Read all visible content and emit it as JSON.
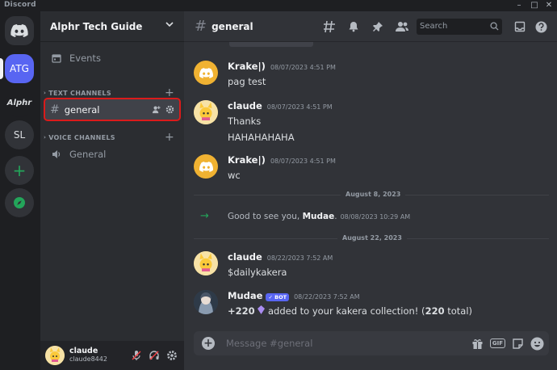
{
  "titlebar": {
    "app_name": "Discord"
  },
  "servers": [
    {
      "label": "ATG",
      "name": "Alphr Tech Guide"
    },
    {
      "label": "Alphr"
    },
    {
      "label": "SL"
    }
  ],
  "guild": {
    "name": "Alphr Tech Guide"
  },
  "sidebar": {
    "events_label": "Events",
    "text_category": "TEXT CHANNELS",
    "active_channel": "general",
    "voice_category": "VOICE CHANNELS",
    "voice_channel": "General"
  },
  "user": {
    "name": "claude",
    "tag": "claude8442"
  },
  "header": {
    "channel": "general",
    "search_placeholder": "Search"
  },
  "messages": [
    {
      "author": "Krake|)",
      "time": "08/07/2023 4:51 PM",
      "lines": [
        "pag test"
      ]
    },
    {
      "author": "claude",
      "time": "08/07/2023 4:51 PM",
      "lines": [
        "Thanks",
        "HAHAHAHAHA"
      ]
    },
    {
      "author": "Krake|)",
      "time": "08/07/2023 4:51 PM",
      "lines": [
        "wc"
      ]
    }
  ],
  "dividers": [
    "August 8, 2023",
    "August 22, 2023"
  ],
  "system_message": {
    "prefix": "Good to see you, ",
    "user": "Mudae",
    "suffix": ".",
    "time": "08/08/2023 10:29 AM"
  },
  "messages2": [
    {
      "author": "claude",
      "time": "08/22/2023 7:52 AM",
      "lines": [
        "$dailykakera"
      ]
    },
    {
      "author": "Mudae",
      "badge": "BOT",
      "time": "08/22/2023 7:52 AM",
      "amount": "+220",
      "text_mid": " added to your kakera collection! (",
      "total": "220",
      "text_end": " total)"
    }
  ],
  "composer": {
    "placeholder": "Message #general",
    "gif_label": "GIF"
  },
  "colors": {
    "accent": "#5865f2",
    "highlight_outline": "#da1b1b",
    "online_green": "#23a55a"
  }
}
